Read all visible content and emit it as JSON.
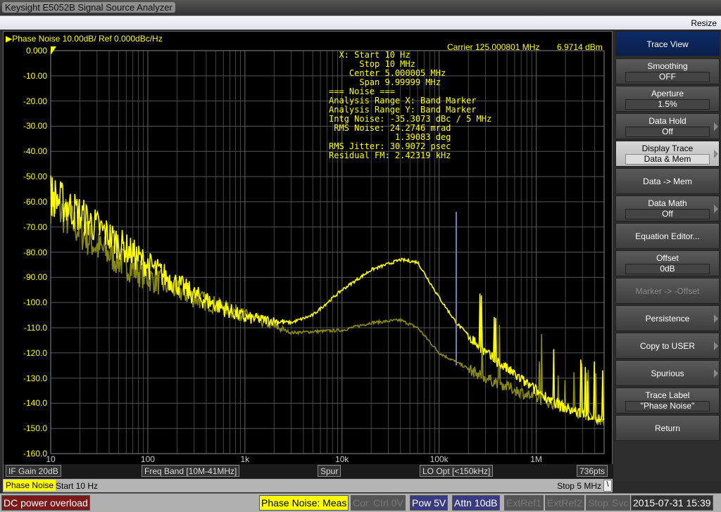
{
  "window": {
    "title": "Keysight E5052B Signal Source Analyzer",
    "resize": "Resize"
  },
  "header": {
    "trace_label": "Phase Noise 10.00dB/ Ref 0.000dBc/Hz",
    "carrier": "Carrier 125.000801 MHz",
    "carrier_power": "6.9714 dBm"
  },
  "annotation": [
    "  X: Start 10 Hz",
    "      Stop 10 MHz",
    "    Center 5.000005 MHz",
    "      Span 9.99999 MHz",
    "=== Noise ===",
    "Analysis Range X: Band Marker",
    "Analysis Range Y: Band Marker",
    "Intg Noise: -35.3073 dBc / 5 MHz",
    " RMS Noise: 24.2746 mrad",
    "             1.39083 deg",
    "RMS Jitter: 30.9072 psec",
    "Residual FM: 2.42319 kHz"
  ],
  "chips": [
    "IF Gain 20dB",
    "Freq Band [10M-41MHz]",
    "Spur",
    "LO Opt [<150kHz]",
    "736pts"
  ],
  "status1": {
    "trace": "Phase Noise",
    "start": "Start 10 Hz",
    "stop": "Stop 5 MHz",
    "backslash": "\\"
  },
  "status2": {
    "error": "DC power overload",
    "meas": "Phase Noise: Meas",
    "cor": "Cor",
    "ctrl": "Ctrl  0V",
    "pow": "Pow  5V",
    "attn": "Attn 10dB",
    "extref1": "ExtRef1",
    "extref2": "ExtRef2",
    "stop": "Stop",
    "svc": "Svc",
    "datetime": "2015-07-31 15:39"
  },
  "softkeys": [
    {
      "label": "Trace View",
      "type": "head"
    },
    {
      "label": "Smoothing",
      "value": "OFF"
    },
    {
      "label": "Aperture",
      "value": "1.5%"
    },
    {
      "label": "Data Hold",
      "value": "Off",
      "arrow": true
    },
    {
      "label": "Display Trace",
      "value": "Data & Mem",
      "arrow": true,
      "selected": true
    },
    {
      "label": "Data -> Mem"
    },
    {
      "label": "Data Math",
      "value": "Off",
      "arrow": true
    },
    {
      "label": "Equation Editor..."
    },
    {
      "label": "Offset",
      "value": "0dB"
    },
    {
      "label": "Marker -> -Offset",
      "disabled": true
    },
    {
      "label": "Persistence",
      "arrow": true
    },
    {
      "label": "Copy to USER",
      "arrow": true
    },
    {
      "label": "Spurious",
      "arrow": true
    },
    {
      "label": "Trace Label",
      "value": "\"Phase Noise\""
    },
    {
      "label": "Return"
    }
  ],
  "colors": {
    "data": "#ffff00",
    "memory": "#8a8a10",
    "spike": "#8080b0",
    "grid": "#555555",
    "error": "#7a1a1a",
    "pow": "#3a3a80"
  },
  "chart_data": {
    "type": "line",
    "xscale": "log",
    "xlim": [
      10,
      5000000
    ],
    "ylim": [
      -160,
      0
    ],
    "yticks": [
      "0.000",
      "-10.00",
      "-20.00",
      "-30.00",
      "-40.00",
      "-50.00",
      "-60.00",
      "-70.00",
      "-80.00",
      "-90.00",
      "-100.0",
      "-110.0",
      "-120.0",
      "-130.0",
      "-140.0",
      "-150.0",
      "-160.0"
    ],
    "xticks": [
      {
        "v": 10,
        "label": "10"
      },
      {
        "v": 100,
        "label": "100"
      },
      {
        "v": 1000,
        "label": "1k"
      },
      {
        "v": 10000,
        "label": "10k"
      },
      {
        "v": 100000,
        "label": "100k"
      },
      {
        "v": 1000000,
        "label": "1M"
      }
    ],
    "series": [
      {
        "id": "data",
        "x": [
          10,
          20,
          30,
          100,
          300,
          1000,
          3000,
          5000,
          10000,
          20000,
          40000,
          60000,
          100000,
          150000,
          300000,
          1000000,
          2000000,
          5000000
        ],
        "y": [
          -57,
          -65,
          -70,
          -85,
          -97,
          -106,
          -108,
          -105,
          -95,
          -87,
          -83,
          -84,
          -98,
          -108,
          -120,
          -135,
          -142,
          -147
        ]
      },
      {
        "id": "memory",
        "x": [
          10,
          30,
          100,
          300,
          1000,
          3000,
          10000,
          20000,
          40000,
          60000,
          100000,
          300000,
          1000000,
          5000000
        ],
        "y": [
          -60,
          -78,
          -90,
          -98,
          -105,
          -112,
          -111,
          -108,
          -107,
          -110,
          -120,
          -130,
          -138,
          -147
        ]
      },
      {
        "id": "spike",
        "x": [
          150000,
          150000
        ],
        "y": [
          -125,
          -64
        ]
      }
    ]
  }
}
